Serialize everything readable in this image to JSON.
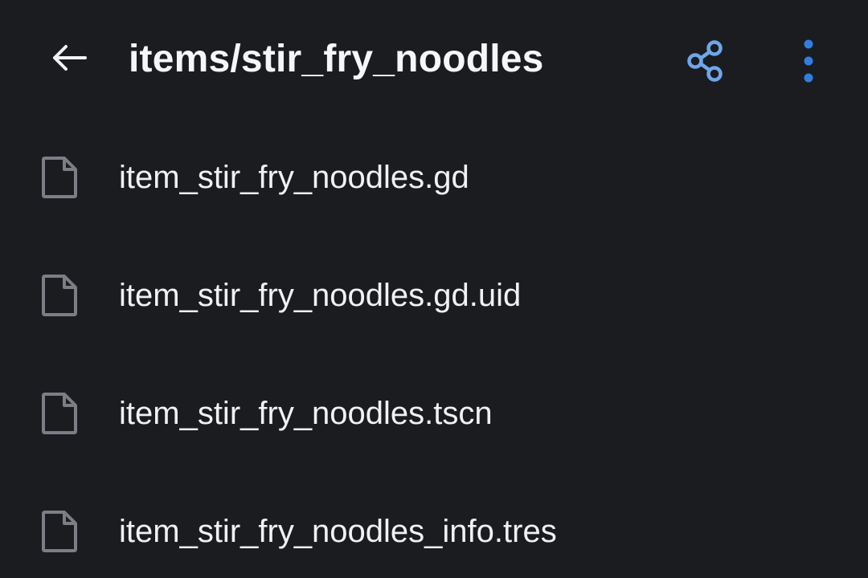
{
  "app_bar": {
    "back_icon": "arrow-left-icon",
    "title": "items/stir_fry_noodles",
    "share_icon": "share-icon",
    "more_icon": "more-vertical-icon"
  },
  "files": [
    {
      "name": "item_stir_fry_noodles.gd",
      "icon": "file-icon"
    },
    {
      "name": "item_stir_fry_noodles.gd.uid",
      "icon": "file-icon"
    },
    {
      "name": "item_stir_fry_noodles.tscn",
      "icon": "file-icon"
    },
    {
      "name": "item_stir_fry_noodles_info.tres",
      "icon": "file-icon"
    }
  ],
  "colors": {
    "background": "#1b1c20",
    "text": "#f3f3f5",
    "accent_share": "#6fa6ea",
    "accent_more": "#2f7fe0",
    "file_icon": "#7c7d85"
  }
}
